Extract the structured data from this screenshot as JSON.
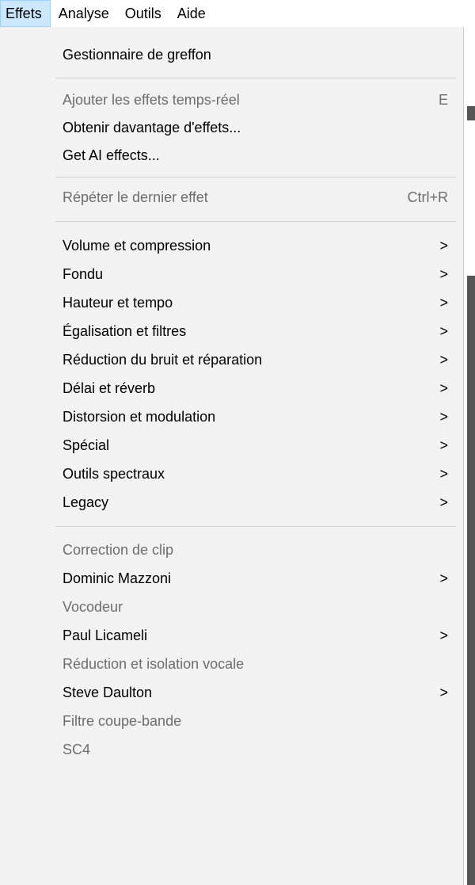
{
  "menubar": [
    {
      "label": "Effets",
      "active": true
    },
    {
      "label": "Analyse",
      "active": false
    },
    {
      "label": "Outils",
      "active": false
    },
    {
      "label": "Aide",
      "active": false
    }
  ],
  "menu": {
    "plugin_manager": "Gestionnaire de greffon",
    "add_realtime": {
      "label": "Ajouter les effets temps-réel",
      "shortcut": "E"
    },
    "get_more": "Obtenir davantage d'effets...",
    "get_ai": "Get AI effects...",
    "repeat_last": {
      "label": "Répéter le dernier effet",
      "shortcut": "Ctrl+R"
    },
    "submenus": [
      "Volume et compression",
      "Fondu",
      "Hauteur et tempo",
      "Égalisation et filtres",
      "Réduction du bruit et réparation",
      "Délai et réverb",
      "Distorsion et modulation",
      "Spécial",
      "Outils spectraux",
      "Legacy"
    ],
    "plugins": [
      {
        "label": "Correction de clip",
        "disabled": true,
        "submenu": false
      },
      {
        "label": "Dominic Mazzoni",
        "disabled": false,
        "submenu": true
      },
      {
        "label": "Vocodeur",
        "disabled": true,
        "submenu": false
      },
      {
        "label": "Paul Licameli",
        "disabled": false,
        "submenu": true
      },
      {
        "label": "Réduction et isolation vocale",
        "disabled": true,
        "submenu": false
      },
      {
        "label": "Steve Daulton",
        "disabled": false,
        "submenu": true
      },
      {
        "label": "Filtre coupe-bande",
        "disabled": true,
        "submenu": false
      },
      {
        "label": "SC4",
        "disabled": true,
        "submenu": false
      }
    ],
    "arrow_glyph": ">"
  },
  "colors": {
    "menu_bg": "#f2f2f2",
    "active_bg": "#cce8ff",
    "disabled_text": "#6d6d6d"
  }
}
